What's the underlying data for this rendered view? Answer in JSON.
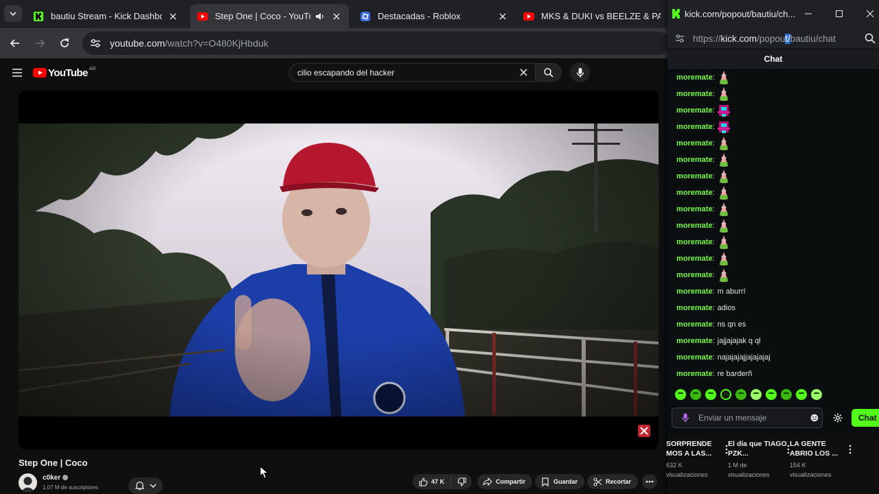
{
  "tabs": [
    {
      "title": "bautiu Stream - Kick Dashboard",
      "icon": "kick-icon"
    },
    {
      "title": "Step One | Coco - YouTube",
      "icon": "youtube-icon",
      "active": true
    },
    {
      "title": "Destacadas - Roblox",
      "icon": "roblox-icon"
    },
    {
      "title": "MKS & DUKI vs BEELZE & PAULI",
      "icon": "youtube-icon"
    }
  ],
  "address": {
    "host": "youtube.com",
    "path": "/watch?v=O480KjHbduk"
  },
  "youtube": {
    "logo": "YouTube",
    "region": "AR",
    "search_query": "cilio escapando del hacker",
    "video_title": "Step One | Coco",
    "channel_name": "c0ker",
    "subscribers": "1,07 M de suscriptores",
    "likes": "47 K",
    "share_label": "Compartir",
    "save_label": "Guardar",
    "clip_label": "Recortar"
  },
  "kick_window": {
    "title": "kick.com/popout/bautiu/ch...",
    "url_scheme": "https://",
    "url_host": "kick.com",
    "url_path_a": "/popou",
    "url_path_sel": "t/",
    "url_path_b": "bautiu/chat",
    "chat_header": "Chat",
    "messages": [
      {
        "user": "moremate",
        "emote": "patrick"
      },
      {
        "user": "moremate",
        "emote": "patrick"
      },
      {
        "user": "moremate",
        "emote": "glitch"
      },
      {
        "user": "moremate",
        "emote": "glitch"
      },
      {
        "user": "moremate",
        "emote": "patrick"
      },
      {
        "user": "moremate",
        "emote": "patrick"
      },
      {
        "user": "moremate",
        "emote": "patrick"
      },
      {
        "user": "moremate",
        "emote": "patrick"
      },
      {
        "user": "moremate",
        "emote": "patrick"
      },
      {
        "user": "moremate",
        "emote": "patrick"
      },
      {
        "user": "moremate",
        "emote": "patrick"
      },
      {
        "user": "moremate",
        "emote": "patrick"
      },
      {
        "user": "moremate",
        "emote": "patrick"
      },
      {
        "user": "moremate",
        "text": "m aburrí"
      },
      {
        "user": "moremate",
        "text": "adios"
      },
      {
        "user": "moremate",
        "text": "ns qn es"
      },
      {
        "user": "moremate",
        "text": "jajjajajak q ql"
      },
      {
        "user": "moremate",
        "text": "najajajajjajajajaj"
      },
      {
        "user": "moremate",
        "text": "re barderñ"
      }
    ],
    "input_placeholder": "Enviar un mensaje",
    "send_label": "Chat"
  },
  "shorts": [
    {
      "title": "SORPRENDE MOS A LAS...",
      "views": "632 K visualizaciones"
    },
    {
      "title": "El día que TIAGO PZK...",
      "views": "1 M de visualizaciones"
    },
    {
      "title": "LA GENTE ABRIO LOS ...",
      "views": "154 K visualizaciones"
    }
  ],
  "colors": {
    "kick_green": "#53fc18",
    "username_green": "#75fd46",
    "yt_red": "#ff0000"
  }
}
